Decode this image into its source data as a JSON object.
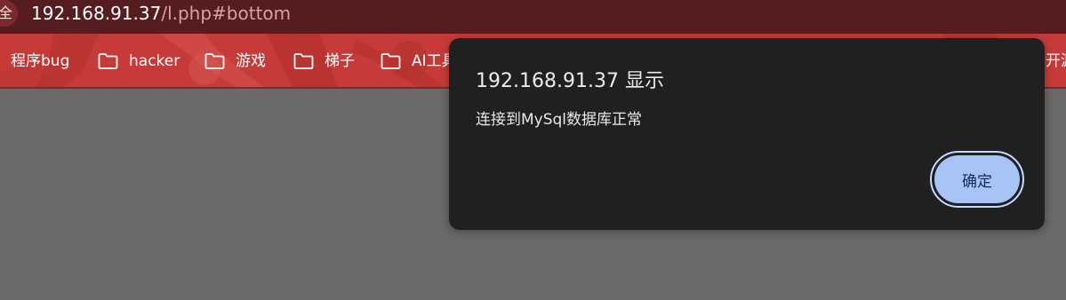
{
  "address_bar": {
    "site_info_glyph": "全",
    "url_host": "192.168.91.37",
    "url_path": "/l.php#bottom"
  },
  "bookmarks": [
    {
      "label": "程序bug",
      "icon": "none"
    },
    {
      "label": "hacker",
      "icon": "folder-icon"
    },
    {
      "label": "游戏",
      "icon": "folder-icon"
    },
    {
      "label": "梯子",
      "icon": "folder-icon"
    },
    {
      "label": "AI工具",
      "icon": "folder-icon"
    },
    {
      "label": "开源",
      "icon": "none"
    }
  ],
  "dialog": {
    "title": "192.168.91.37 显示",
    "message": "连接到MySql数据库正常",
    "ok_label": "确定"
  },
  "colors": {
    "address_bar_bg": "#551d1f",
    "bookmarks_bg": "#c93f3c",
    "page_bg": "#6a6a6a",
    "dialog_bg": "#202020",
    "button_bg": "#a8c3f6",
    "button_text": "#0f2a56"
  }
}
